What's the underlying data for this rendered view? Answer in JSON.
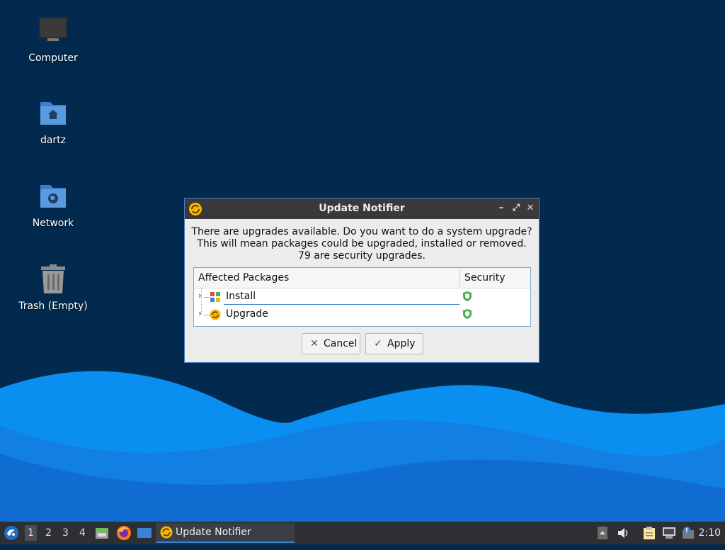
{
  "desktop": {
    "icons": [
      {
        "label": "Computer"
      },
      {
        "label": "dartz"
      },
      {
        "label": "Network"
      },
      {
        "label": "Trash (Empty)"
      }
    ]
  },
  "dialog": {
    "title": "Update Notifier",
    "message_line1": "There are upgrades available. Do you want to do a system upgrade?",
    "message_line2": "This will mean packages could be upgraded, installed or removed.",
    "message_line3": "79 are security upgrades.",
    "columns": {
      "packages": "Affected Packages",
      "security": "Security"
    },
    "rows": [
      {
        "label": "Install",
        "icon": "package-install-icon"
      },
      {
        "label": "Upgrade",
        "icon": "update-icon"
      }
    ],
    "cancel_label": "Cancel",
    "apply_label": "Apply"
  },
  "taskbar": {
    "workspaces": [
      "1",
      "2",
      "3",
      "4"
    ],
    "active_workspace": "1",
    "task_label": "Update Notifier",
    "clock": "2:10"
  },
  "colors": {
    "desktop_bg": "#022a4e",
    "wave_light": "#0a8ff0",
    "accent": "#3b82d6",
    "security_green": "#4caf50"
  }
}
